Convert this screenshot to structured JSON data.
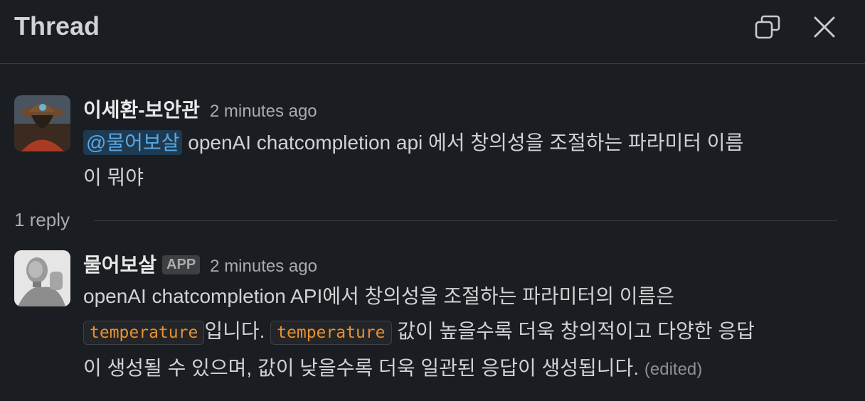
{
  "header": {
    "title": "Thread"
  },
  "icons": {
    "popout": "popout-window-icon",
    "close": "close-icon"
  },
  "colors": {
    "background": "#1a1d21",
    "mention_bg": "#1d3a52",
    "mention_text": "#5aa7e0",
    "code_text": "#e8912d"
  },
  "messages": [
    {
      "author": "이세환-보안관",
      "time": "2 minutes ago",
      "mention": "@물어보살",
      "text_line1": " openAI chatcompletion api 에서 창의성을 조절하는 파라미터 이름",
      "text_line2": "이 뭐야"
    },
    {
      "author": "물어보살",
      "badge": "APP",
      "time": "2 minutes ago",
      "text_intro": "openAI chatcompletion API에서 창의성을 조절하는 파라미터의 이름은",
      "code1": "temperature",
      "text_mid": "입니다. ",
      "code2": "temperature",
      "text_after": " 값이 높을수록 더욱 창의적이고 다양한 응답",
      "text_line3": "이 생성될 수 있으며, 값이 낮을수록 더욱 일관된 응답이 생성됩니다. ",
      "edited": "(edited)"
    }
  ],
  "thread": {
    "reply_count": "1 reply"
  }
}
